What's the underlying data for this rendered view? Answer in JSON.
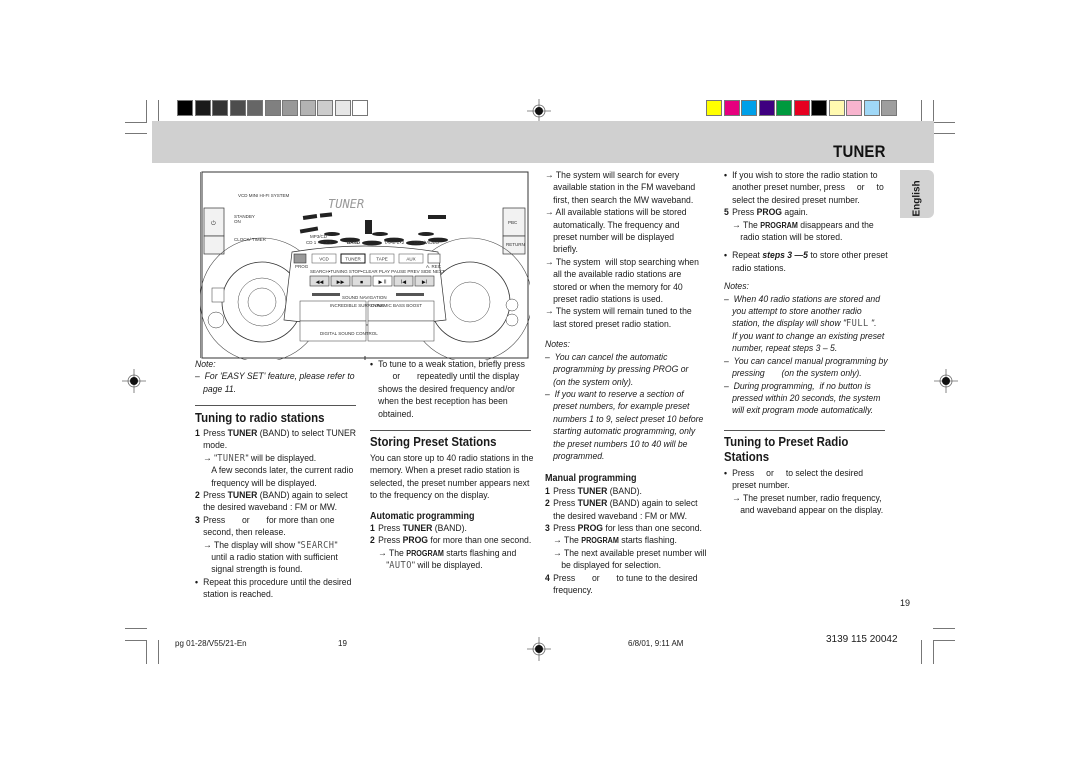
{
  "header": {
    "title": "TUNER",
    "language_tab": "English"
  },
  "color_bars": {
    "grayscale": [
      "#000000",
      "#1a1a1a",
      "#333333",
      "#4d4d4d",
      "#666666",
      "#808080",
      "#999999",
      "#b3b3b3",
      "#cccccc",
      "#e6e6e6",
      "#ffffff"
    ],
    "colors": [
      "#ffff00",
      "#e6007e",
      "#00a0e9",
      "#3f0080",
      "#009a3e",
      "#e60020",
      "#000000",
      "#fff9b0",
      "#f8b4ce",
      "#a0d8f7",
      "#9e9e9e"
    ]
  },
  "device": {
    "system_name": "VCD MINI HI-FI SYSTEM",
    "display_text": "TUNER",
    "standby": "STANDBY",
    "on": "ON",
    "clock_timer": "CLOCK/ TIMER",
    "source_caption_1": "MP3/CD",
    "source_caption_1b": "CD 1 × 2 × 3",
    "source_caption_2": "BAND",
    "source_caption_3": "TAPE 1×2",
    "source_caption_4": "CDR/VIDEO",
    "buttons": [
      "VCD",
      "TUNER",
      "TAPE",
      "AUX"
    ],
    "prog": "PROG",
    "rec": "A. REC",
    "pbc": "PBC",
    "return": "RETURN",
    "transport_labels": "SEARCH•TUNING   STOP•CLEAR  PLAY  PAUSE   PREV  SIDE  NEXT",
    "preset": "PRESET",
    "sound_navigation": "SOUND NAVIGATION",
    "incredible_surround": "INCREDIBLE SURROUND",
    "dynamic_bass_boost": "DYNAMIC BASS BOOST",
    "digital_sound_control": "DIGITAL SOUND CONTROL"
  },
  "col1": {
    "note_label": "Note:",
    "note_item": "For 'EASY SET' feature, please refer to",
    "note_item_2": "page 11.",
    "section_title": "Tuning to radio stations",
    "s1_a": "Press ",
    "s1_b": "TUNER",
    "s1_c": " (BAND) to select TUNER",
    "s1_d": "mode.",
    "s1_r1a": "\"",
    "s1_r1_lcd": "TUNER",
    "s1_r1b": "\"  will be displayed.",
    "s1_r2": "A few seconds later, the current radio",
    "s1_r3": "frequency will be displayed.",
    "s2_a": "Press ",
    "s2_b": "TUNER",
    "s2_c": " (BAND) again to select",
    "s2_d": "the desired waveband : FM or MW.",
    "s3_a": "Press       or       for more than one",
    "s3_b": "second, then release.",
    "s3_r1a": "The display will show \"",
    "s3_r1_lcd": "SEARCH",
    "s3_r1b": "\"",
    "s3_r2": "until a radio station with sufficient",
    "s3_r3": "signal strength is found.",
    "bullet_a": "Repeat this procedure until the desired",
    "bullet_b": "station is reached.",
    "nums": [
      "1",
      "2",
      "3"
    ]
  },
  "col2": {
    "bullet_1": "To tune to a weak station, briefly press",
    "bullet_2": "      or       repeatedly until the display",
    "bullet_3": "shows the desired frequency and/or",
    "bullet_4": "when the best reception has been",
    "bullet_5": "obtained.",
    "section_title": "Storing Preset Stations",
    "intro_1": "You can store up to 40 radio stations in the",
    "intro_2": "memory. When a preset radio station is",
    "intro_3": "selected, the preset number appears next",
    "intro_4": "to the frequency on the display.",
    "auto_title": "Automatic programming",
    "a1_a": "Press ",
    "a1_b": "TUNER",
    "a1_c": " (BAND).",
    "a2_a": "Press ",
    "a2_b": "PROG",
    "a2_c": " for more than one second.",
    "a2_r1a": "The ",
    "a2_r1_sc": "PROGRAM",
    "a2_r1b": " starts flashing and",
    "a2_r2a": "\"",
    "a2_r2_lcd": "AUTO",
    "a2_r2b": "\" will be displayed.",
    "nums": [
      "1",
      "2"
    ]
  },
  "col3": {
    "r1": [
      "The system will search for every",
      "available station in the FM waveband",
      "first, then search the MW waveband."
    ],
    "r2": [
      "All available stations will be stored",
      "automatically. The frequency and",
      "preset number will be displayed",
      "briefly."
    ],
    "r3": [
      "The system  will stop searching when",
      "all the available radio stations are",
      "stored or when the memory for 40",
      "preset radio stations is used."
    ],
    "r4": [
      "The system will remain tuned to the",
      "last stored preset radio station."
    ],
    "notes_label": "Notes:",
    "n1": [
      "You can cancel the automatic",
      "programming by pressing PROG or",
      "(on the system only)."
    ],
    "n2": [
      "If you want to reserve a section of",
      "preset numbers, for example preset",
      "numbers 1 to 9, select preset 10 before",
      "starting automatic programming, only",
      "the preset numbers 10 to 40 will be",
      "programmed."
    ],
    "manual_title": "Manual programming",
    "m1_a": "Press ",
    "m1_b": "TUNER",
    "m1_c": " (BAND).",
    "m2_a": "Press ",
    "m2_b": "TUNER",
    "m2_c": " (BAND) again to select",
    "m2_d": "the desired waveband : FM or MW.",
    "m3_a": "Press ",
    "m3_b": "PROG",
    "m3_c": " for less than one second.",
    "m3_r1a": "The ",
    "m3_r1_sc": "PROGRAM",
    "m3_r1b": " starts flashing.",
    "m3_r2": "The next available preset number will",
    "m3_r3": "be displayed for selection.",
    "m4_a": "Press       or       to tune to the desired",
    "m4_b": "frequency.",
    "nums": [
      "1",
      "2",
      "3",
      "4"
    ]
  },
  "col4": {
    "b1": [
      "If you wish to store the radio station to",
      "another preset number, press     or     to",
      "select the desired preset number."
    ],
    "s5_num": "5",
    "s5_a": "Press ",
    "s5_b": "PROG",
    "s5_c": " again.",
    "s5_r1a": "The ",
    "s5_r1_sc": "PROGRAM",
    "s5_r1b": " disappears and the",
    "s5_r2": "radio station will be stored.",
    "b2_a": "Repeat ",
    "b2_b": "steps 3 —5",
    "b2_c": " to store other preset",
    "b2_d": "radio stations.",
    "notes_label": "Notes:",
    "n1": [
      "When 40 radio stations are stored and",
      "you attempt to store another radio"
    ],
    "n1_3a": "station, the display will show \"",
    "n1_3_lcd": "FULL",
    "n1_3b": " \".",
    "n1_rest": [
      "If you want to change an existing preset",
      "number, repeat steps 3 – 5."
    ],
    "n2": [
      "You can cancel manual programming by",
      "pressing       (on the system only)."
    ],
    "n3": [
      "During programming,  if no button is",
      "pressed within 20 seconds, the system",
      "will exit program mode automatically."
    ],
    "section_title_1": "Tuning to Preset Radio",
    "section_title_2": "Stations",
    "b3": [
      "Press     or     to select the desired",
      "preset number."
    ],
    "b3_r": [
      "The preset number, radio frequency,",
      "and waveband appear on the display."
    ]
  },
  "page_number": "19",
  "footer": {
    "file": "pg 01-28/V55/21-En",
    "page": "19",
    "datetime": "6/8/01, 9:11 AM",
    "code": "3139 115 20042"
  },
  "symbols": {
    "arrow": "→",
    "bullet": "•",
    "dash": "–"
  }
}
